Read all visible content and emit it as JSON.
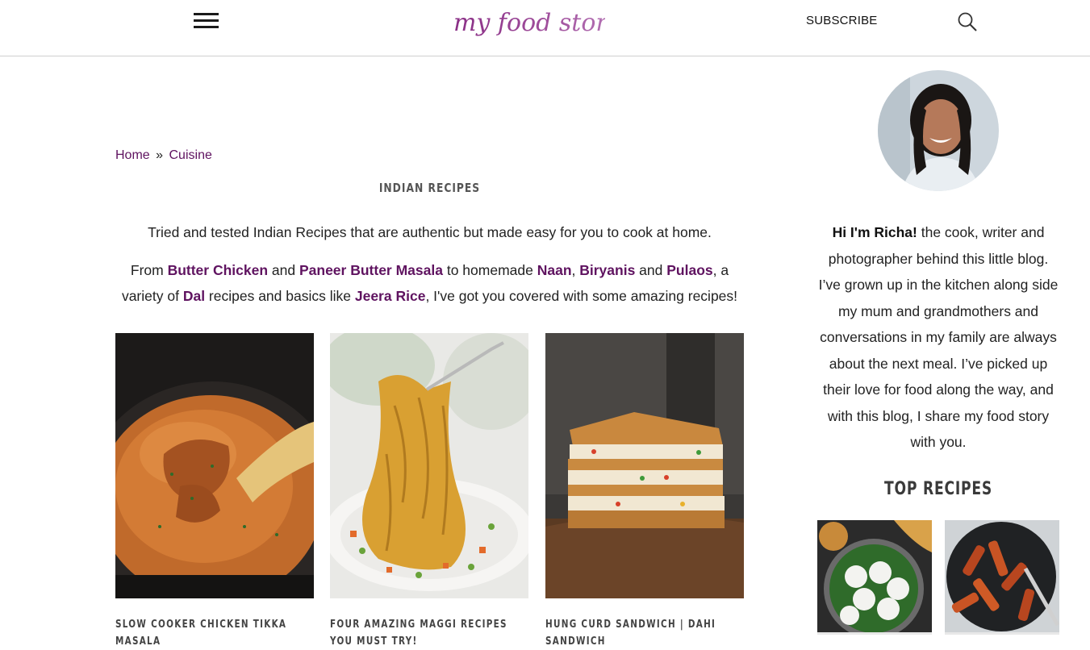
{
  "header": {
    "logo_text": "my food story",
    "subscribe_label": "SUBSCRIBE"
  },
  "breadcrumb": {
    "home": "Home",
    "separator": "»",
    "current": "Cuisine"
  },
  "page": {
    "title": "INDIAN RECIPES",
    "intro_1": "Tried and tested Indian Recipes that are authentic but made easy for you to cook at home.",
    "intro_2": {
      "t1": "From ",
      "l1": "Butter Chicken",
      "t2": " and ",
      "l2": "Paneer Butter Masala",
      "t3": " to homemade ",
      "l3": "Naan",
      "t4": ", ",
      "l4": "Biryanis",
      "t5": " and ",
      "l5": "Pulaos",
      "t6": ", a variety of ",
      "l6": "Dal",
      "t7": " recipes and basics like ",
      "l7": "Jeera Rice",
      "t8": ", I've got you covered with some amazing recipes!"
    }
  },
  "recipes": [
    {
      "title": "SLOW COOKER CHICKEN TIKKA MASALA"
    },
    {
      "title": "FOUR AMAZING MAGGI RECIPES YOU MUST TRY!"
    },
    {
      "title": "HUNG CURD SANDWICH | DAHI SANDWICH"
    }
  ],
  "sidebar": {
    "bio_name": "Hi I'm Richa!",
    "bio_text": " the cook, writer and photographer behind this little blog. I’ve grown up in the kitchen along side my mum and grandmothers and conversations in my family are always about the next meal. I’ve picked up their love for food along the way, and with this blog, I share my food story with you.",
    "top_recipes_title": "TOP RECIPES"
  },
  "icons": {
    "menu": "hamburger-menu-icon",
    "search": "search-icon"
  },
  "colors": {
    "link": "#5f1360",
    "logo_purple": "#8a3a8f",
    "logo_pink": "#b05aa8"
  }
}
